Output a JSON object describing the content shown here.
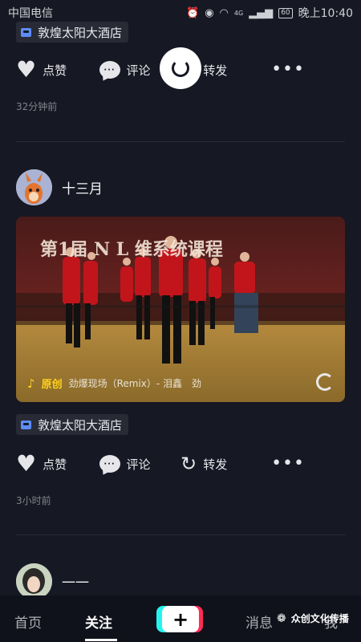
{
  "status_bar": {
    "carrier": "中国电信",
    "network": "4G",
    "battery": "60",
    "time": "晚上10:40"
  },
  "post1": {
    "location": "敦煌太阳大酒店",
    "actions": {
      "like": "点赞",
      "comment": "评论",
      "share": "转发"
    },
    "time_ago": "32分钟前"
  },
  "post2": {
    "author": "十三月",
    "video": {
      "banner_text": "第1届 N L   维系统课程",
      "music_tag": "原创",
      "music_title": "劲爆现场（Remix）- 泪鑫　劲"
    },
    "location": "敦煌太阳大酒店",
    "actions": {
      "like": "点赞",
      "comment": "评论",
      "share": "转发"
    },
    "time_ago": "3小时前"
  },
  "post3": {
    "author": "一一"
  },
  "bottom_nav": {
    "home": "首页",
    "following": "关注",
    "plus": "+",
    "messages": "消息",
    "me": "我"
  },
  "watermark": "众创文化传播",
  "colors": {
    "background": "#161823",
    "accent_yellow": "#ffd21e",
    "brand_cyan": "#25f4ee",
    "brand_red": "#fe2c55"
  },
  "icons": [
    "heart-icon",
    "comment-icon",
    "share-icon",
    "more-icon",
    "location-icon",
    "music-note-icon",
    "loading-spinner-icon",
    "wechat-icon"
  ]
}
